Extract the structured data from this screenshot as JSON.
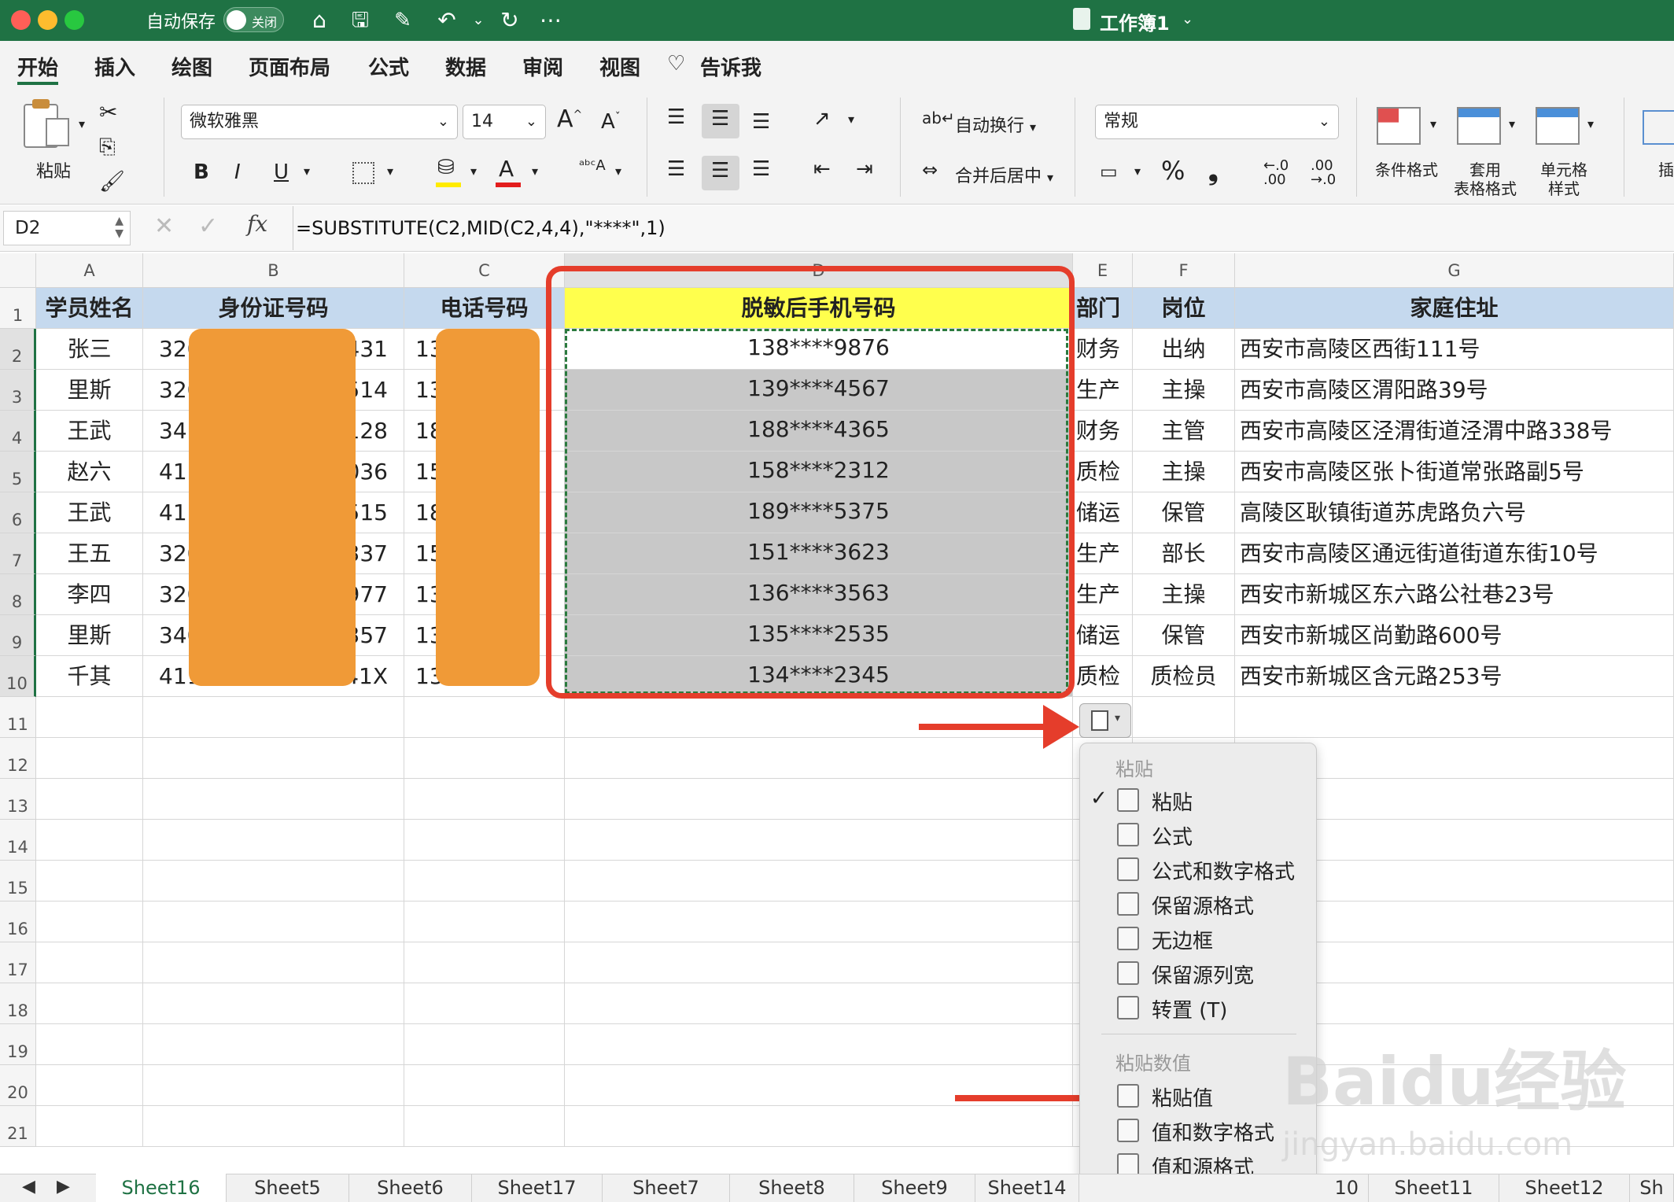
{
  "titlebar": {
    "autosave": "自动保存",
    "toggle": "关闭",
    "doc_title": "工作簿1"
  },
  "tabs": [
    "开始",
    "插入",
    "绘图",
    "页面布局",
    "公式",
    "数据",
    "审阅",
    "视图",
    "告诉我"
  ],
  "ribbon": {
    "paste": "粘贴",
    "font_name": "微软雅黑",
    "font_size": "14",
    "wrap": "自动换行",
    "merge": "合并后居中",
    "number_format": "常规",
    "cond_format": "条件格式",
    "table_format_1": "套用",
    "table_format_2": "表格格式",
    "cell_style_1": "单元格",
    "cell_style_2": "样式",
    "insert": "插",
    "bold": "B",
    "italic": "I",
    "underline": "U",
    "percent": "%",
    "comma": "❟"
  },
  "formula": {
    "namebox": "D2",
    "fx": "fx",
    "text": "=SUBSTITUTE(C2,MID(C2,4,4),\"****\",1)"
  },
  "columns": [
    "A",
    "B",
    "C",
    "D",
    "E",
    "F",
    "G"
  ],
  "rows": [
    "1",
    "2",
    "3",
    "4",
    "5",
    "6",
    "7",
    "8",
    "9",
    "10",
    "11",
    "12",
    "13",
    "14",
    "15",
    "16",
    "17",
    "18",
    "19",
    "20",
    "21"
  ],
  "headers": {
    "a": "学员姓名",
    "b": "身份证号码",
    "c": "电话号码",
    "d": "脱敏后手机号码",
    "e": "部门",
    "f": "岗位",
    "g": "家庭住址"
  },
  "data": [
    {
      "a": "张三",
      "b1": "320",
      "b2": "431",
      "c": "13",
      "d": "138****9876",
      "e": "财务",
      "f": "出纳",
      "g": "西安市高陵区西街111号"
    },
    {
      "a": "里斯",
      "b1": "320",
      "b2": "514",
      "c": "13",
      "d": "139****4567",
      "e": "生产",
      "f": "主操",
      "g": "西安市高陵区渭阳路39号"
    },
    {
      "a": "王武",
      "b1": "341",
      "b2": "128",
      "c": "18",
      "d": "188****4365",
      "e": "财务",
      "f": "主管",
      "g": "西安市高陵区泾渭街道泾渭中路338号"
    },
    {
      "a": "赵六",
      "b1": "411",
      "b2": "036",
      "c": "15",
      "d": "158****2312",
      "e": "质检",
      "f": "主操",
      "g": "西安市高陵区张卜街道常张路副5号"
    },
    {
      "a": "王武",
      "b1": "411",
      "b2": "515",
      "c": "18",
      "d": "189****5375",
      "e": "储运",
      "f": "保管",
      "g": "高陵区耿镇街道苏虎路负六号"
    },
    {
      "a": "王五",
      "b1": "320",
      "b2": "337",
      "c": "15",
      "d": "151****3623",
      "e": "生产",
      "f": "部长",
      "g": "西安市高陵区通远街道街道东街10号"
    },
    {
      "a": "李四",
      "b1": "320",
      "b2": "977",
      "c": "13",
      "d": "136****3563",
      "e": "生产",
      "f": "主操",
      "g": "西安市新城区东六路公社巷23号"
    },
    {
      "a": "里斯",
      "b1": "340",
      "b2": "357",
      "c": "13",
      "d": "135****2535",
      "e": "储运",
      "f": "保管",
      "g": "西安市新城区尚勤路600号"
    },
    {
      "a": "千其",
      "b1": "411",
      "b2": "41X",
      "c": "13",
      "d": "134****2345",
      "e": "质检",
      "f": "质检员",
      "g": "西安市新城区含元路253号"
    }
  ],
  "paste_menu": {
    "section1": "粘贴",
    "items1": [
      "粘贴",
      "公式",
      "公式和数字格式",
      "保留源格式",
      "无边框",
      "保留源列宽",
      "转置 (T)"
    ],
    "section2": "粘贴数值",
    "items2": [
      "粘贴值",
      "值和数字格式",
      "值和源格式"
    ]
  },
  "sheets": [
    "Sheet16",
    "Sheet5",
    "Sheet6",
    "Sheet17",
    "Sheet7",
    "Sheet8",
    "Sheet9",
    "Sheet14",
    "10",
    "Sheet11",
    "Sheet12",
    "Sh"
  ],
  "watermark": {
    "brand": "Baidu经验",
    "url": "jingyan.baidu.com"
  },
  "colors": {
    "title_bar": "#1f7244",
    "header_fill": "#c5d9ee",
    "highlight_header": "#ffff4d",
    "selection_gray": "#c8c8c8",
    "mask": "#f09a37",
    "annotation_red": "#e53d2b"
  }
}
